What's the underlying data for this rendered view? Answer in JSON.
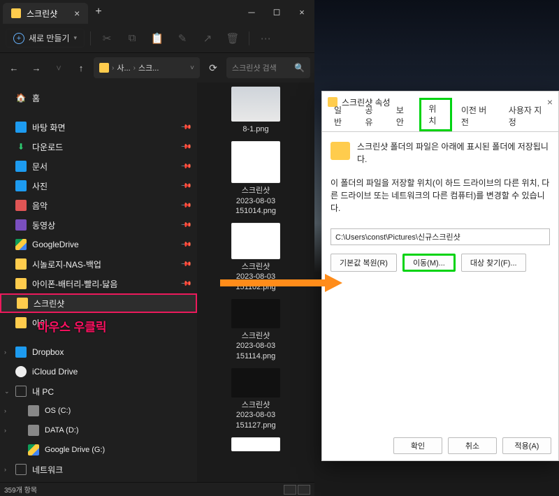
{
  "tab": {
    "title": "스크린샷"
  },
  "toolbar": {
    "new_label": "새로 만들기"
  },
  "breadcrumb": {
    "seg1": "사...",
    "seg2": "스크..."
  },
  "search": {
    "placeholder": "스크린샷 검색"
  },
  "sidebar": {
    "home": "홈",
    "desktop": "바탕 화면",
    "downloads": "다운로드",
    "documents": "문서",
    "pictures": "사진",
    "music": "음악",
    "videos": "동영상",
    "gdrive": "GoogleDrive",
    "synology": "시놀로지-NAS-백업",
    "iphone": "아이폰-배터리-빨리-닳음",
    "screenshots": "스크린샷",
    "ohitem": "아이...",
    "dropbox": "Dropbox",
    "icloud": "iCloud Drive",
    "mypc": "내 PC",
    "osc": "OS (C:)",
    "datad": "DATA (D:)",
    "gdriveg": "Google Drive (G:)",
    "network": "네트워크"
  },
  "files": [
    {
      "name": "8-1.png"
    },
    {
      "name": "스크린샷\n2023-08-03\n151014.png"
    },
    {
      "name": "스크린샷\n2023-08-03\n151102.png"
    },
    {
      "name": "스크린샷\n2023-08-03\n151114.png"
    },
    {
      "name": "스크린샷\n2023-08-03\n151127.png"
    }
  ],
  "status": {
    "count": "359개 항목"
  },
  "annotation": "마우스 우클릭",
  "dialog": {
    "title": "스크린샷 속성",
    "tabs": {
      "general": "일반",
      "share": "공유",
      "security": "보안",
      "location": "위치",
      "prev": "이전 버전",
      "custom": "사용자 지정"
    },
    "info": "스크린샷 폴더의 파일은 아래에 표시된 폴더에 저장됩니다.",
    "para": "이 폴더의 파일을 저장할 위치(이 하드 드라이브의 다른 위치, 다른 드라이브 또는 네트워크의 다른 컴퓨터)를 변경할 수 있습니다.",
    "path": "C:\\Users\\const\\Pictures\\신규스크린샷",
    "btn_restore": "기본값 복원(R)",
    "btn_move": "이동(M)...",
    "btn_find": "대상 찾기(F)...",
    "btn_ok": "확인",
    "btn_cancel": "취소",
    "btn_apply": "적용(A)"
  }
}
